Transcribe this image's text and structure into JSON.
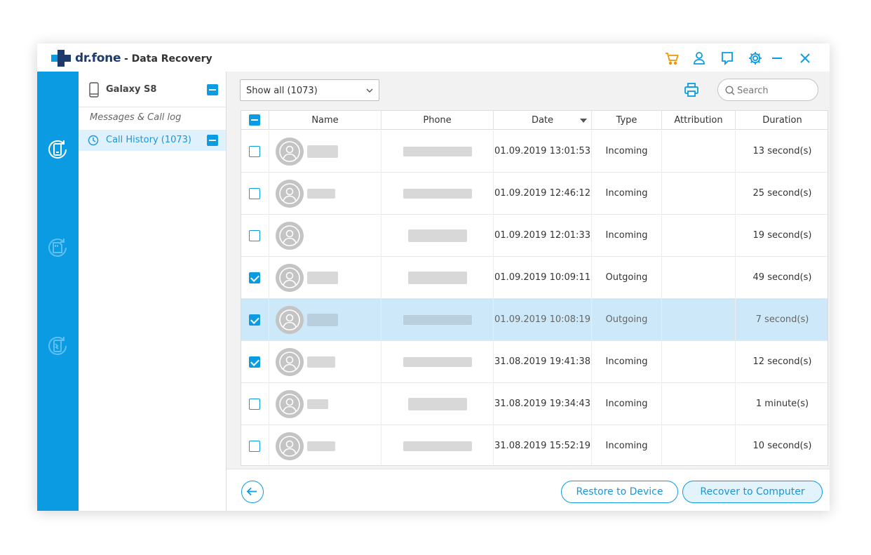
{
  "app": {
    "brand": "dr.fone",
    "subtitle": "- Data Recovery"
  },
  "titlebar_icons": [
    "cart-icon",
    "user-icon",
    "feedback-icon",
    "settings-icon",
    "minimize-icon",
    "close-icon"
  ],
  "sidebar": {
    "device_name": "Galaxy S8",
    "section_label": "Messages & Call log",
    "items": [
      {
        "label": "Call History (1073)",
        "icon": "clock-icon",
        "selected": true
      }
    ]
  },
  "toolbar": {
    "filter_value": "Show all (1073)",
    "search_placeholder": "Search"
  },
  "table": {
    "columns": [
      "Name",
      "Phone",
      "Date",
      "Type",
      "Attribution",
      "Duration"
    ],
    "rows": [
      {
        "checked": false,
        "selected": false,
        "date": "01.09.2019 13:01:53",
        "type": "Incoming",
        "attribution": "",
        "duration": "13 second(s)"
      },
      {
        "checked": false,
        "selected": false,
        "date": "01.09.2019 12:46:12",
        "type": "Incoming",
        "attribution": "",
        "duration": "25 second(s)"
      },
      {
        "checked": false,
        "selected": false,
        "date": "01.09.2019 12:01:33",
        "type": "Incoming",
        "attribution": "",
        "duration": "19 second(s)"
      },
      {
        "checked": true,
        "selected": false,
        "date": "01.09.2019 10:09:11",
        "type": "Outgoing",
        "attribution": "",
        "duration": "49 second(s)"
      },
      {
        "checked": true,
        "selected": true,
        "date": "01.09.2019 10:08:19",
        "type": "Outgoing",
        "attribution": "",
        "duration": "7 second(s)"
      },
      {
        "checked": true,
        "selected": false,
        "date": "31.08.2019 19:41:38",
        "type": "Incoming",
        "attribution": "",
        "duration": "12 second(s)"
      },
      {
        "checked": false,
        "selected": false,
        "date": "31.08.2019 19:34:43",
        "type": "Incoming",
        "attribution": "",
        "duration": "1 minute(s)"
      },
      {
        "checked": false,
        "selected": false,
        "date": "31.08.2019 15:52:19",
        "type": "Incoming",
        "attribution": "",
        "duration": "10 second(s)"
      }
    ]
  },
  "footer": {
    "restore_label": "Restore to Device",
    "recover_label": "Recover to Computer"
  },
  "colors": {
    "accent": "#0a9be3",
    "rail": "#0a9be3",
    "cart": "#f39200",
    "selected_row": "#cde9f9"
  }
}
